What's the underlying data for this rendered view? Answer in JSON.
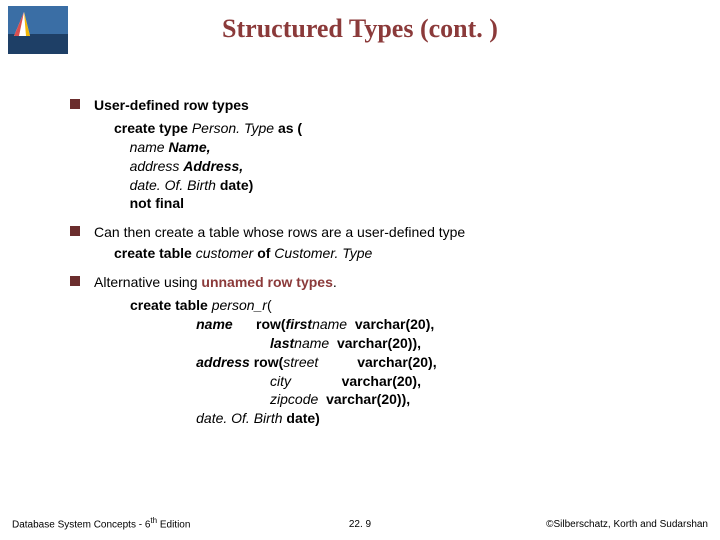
{
  "title": "Structured Types (cont. )",
  "bullets": {
    "b1_label": "User-defined row types",
    "code1": {
      "l1a": "create type ",
      "l1b": "Person. Type ",
      "l1c": "as (",
      "l2a": "name ",
      "l2b": "Name,",
      "l3a": "address ",
      "l3b": "Address,",
      "l4a": "date. Of. Birth ",
      "l4b": "date)",
      "l5": "not final"
    },
    "b2_label": "Can then create a table whose rows are a user-defined type",
    "b2_code_a": "create table ",
    "b2_code_b": "customer ",
    "b2_code_c": "of ",
    "b2_code_d": "Customer. Type",
    "b3_pre": "Alternative using ",
    "b3_redlabel": "unnamed row types",
    "b3_post": ".",
    "code3": {
      "l1a": "create table ",
      "l1b": "person_r",
      "l1c": "(",
      "l2a": "name",
      "l2b": "row(",
      "l2c": "first",
      "l2d": "name  ",
      "l2e": "varchar(20),",
      "l3a": "last",
      "l3b": "name  ",
      "l3c": "varchar(20)),",
      "l4a": "address ",
      "l4b": "row(",
      "l4c": "street",
      "l4d": "varchar(20),",
      "l5a": "city",
      "l5b": "varchar(20),",
      "l6a": "zipcode  ",
      "l6b": "varchar(20)),",
      "l7a": "date. Of. Birth ",
      "l7b": "date)"
    }
  },
  "footer": {
    "left_a": "Database System Concepts - 6",
    "left_sup": "th",
    "left_b": " Edition",
    "center": "22. 9",
    "right": "©Silberschatz, Korth and Sudarshan"
  }
}
